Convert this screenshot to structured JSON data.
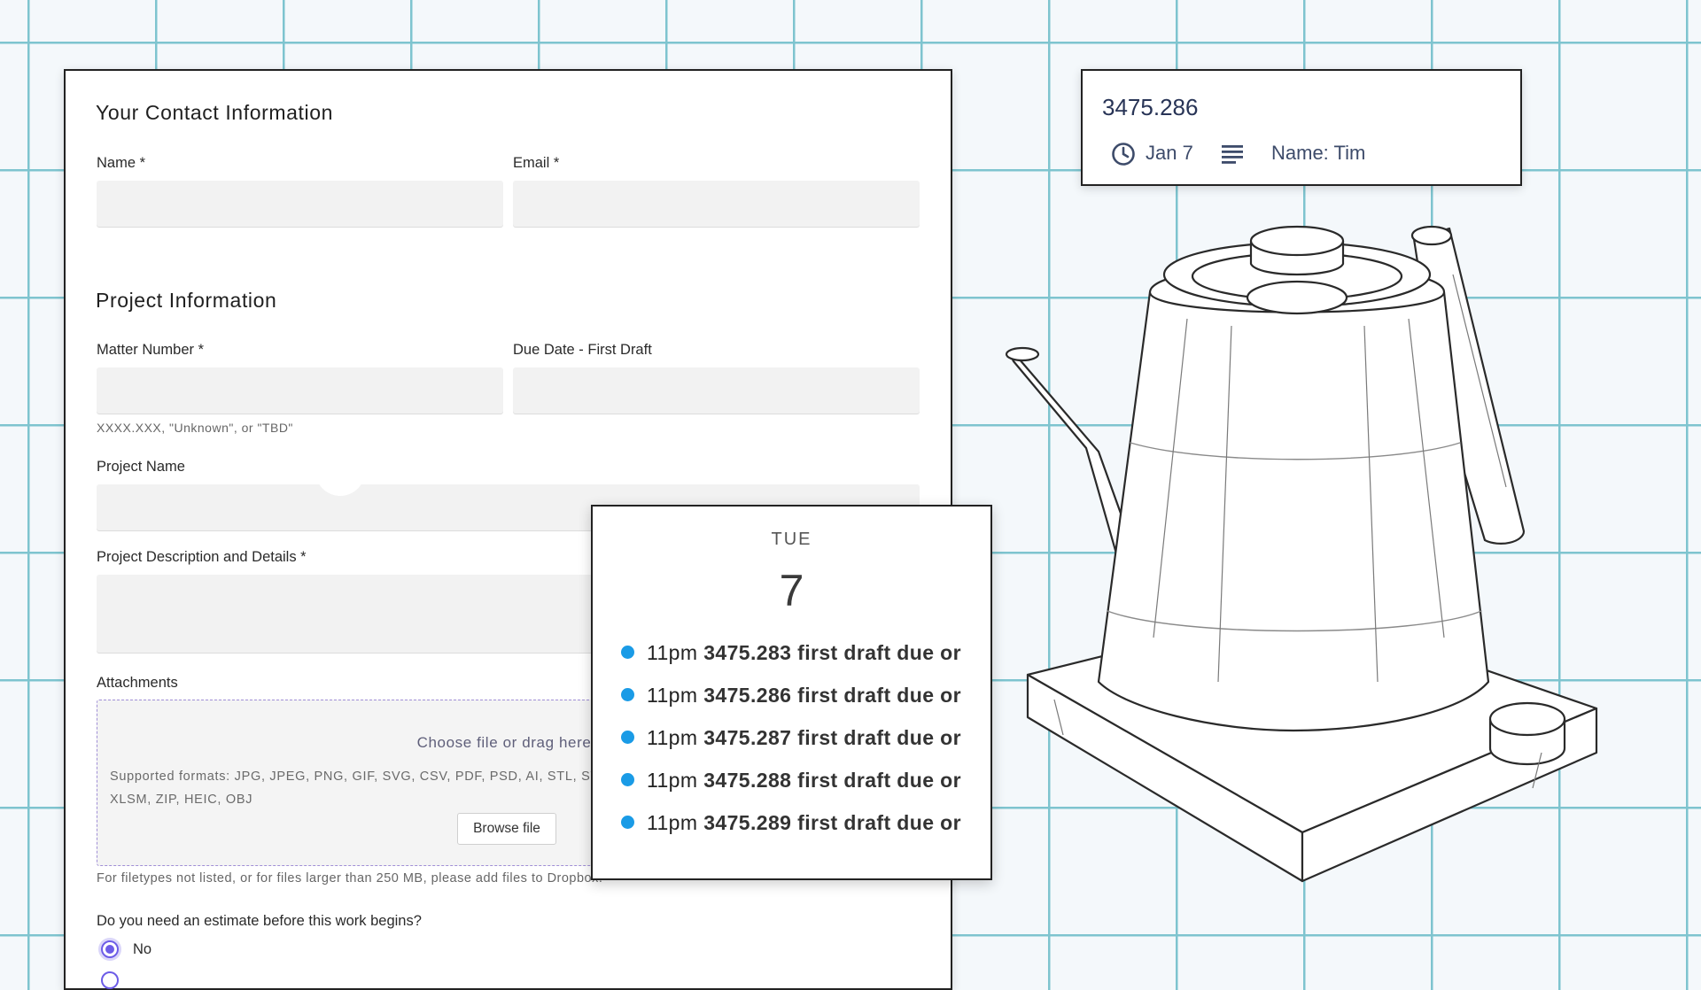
{
  "form": {
    "contact_title": "Your Contact Information",
    "name_label": "Name *",
    "email_label": "Email *",
    "project_title": "Project Information",
    "matter_label": "Matter Number *",
    "due_label": "Due Date - First Draft",
    "matter_hint": "XXXX.XXX, \"Unknown\", or \"TBD\"",
    "project_name_label": "Project Name",
    "description_label": "Project Description and Details *",
    "attachments_label": "Attachments",
    "dropzone_choose": "Choose file or drag here",
    "dropzone_formats": "Supported formats: JPG, JPEG, PNG, GIF, SVG, CSV, PDF, PSD, AI, STL, STP, MOV, MP4, XLS, XLSX, XLSM, ZIP, HEIC, OBJ",
    "browse_label": "Browse file",
    "filesize_note": "For filetypes not listed, or for files larger than 250 MB, please add files to Dropbox.",
    "estimate_question": "Do you need an estimate before this work begins?",
    "estimate_options": [
      "No"
    ]
  },
  "event": {
    "title": "3475.286",
    "date": "Jan 7",
    "name": "Name: Tim",
    "icons": [
      "clock-icon",
      "notes-icon"
    ]
  },
  "day": {
    "weekday": "TUE",
    "date_number": "7",
    "events": [
      {
        "time": "11pm",
        "text": "3475.283 first draft due or"
      },
      {
        "time": "11pm",
        "text": "3475.286 first draft due or"
      },
      {
        "time": "11pm",
        "text": "3475.287 first draft due or"
      },
      {
        "time": "11pm",
        "text": "3475.288 first draft due or"
      },
      {
        "time": "11pm",
        "text": "3475.289 first draft due or"
      }
    ]
  },
  "colors": {
    "grid": "#7ec4cf",
    "background": "#f4f8fb",
    "radio_accent": "#6c5ce7",
    "event_dot": "#1a9be6"
  }
}
